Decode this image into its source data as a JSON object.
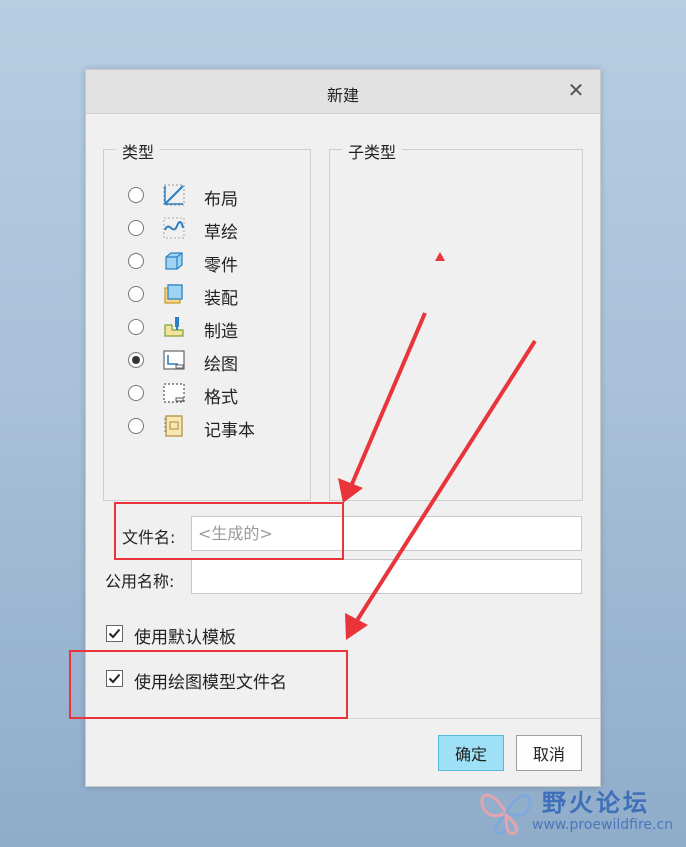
{
  "dialog": {
    "title": "新建",
    "close_icon": "close-icon"
  },
  "type_group": {
    "legend": "类型",
    "items": [
      {
        "label": "布局",
        "icon": "layout-icon",
        "selected": false
      },
      {
        "label": "草绘",
        "icon": "sketch-icon",
        "selected": false
      },
      {
        "label": "零件",
        "icon": "part-icon",
        "selected": false
      },
      {
        "label": "装配",
        "icon": "assembly-icon",
        "selected": false
      },
      {
        "label": "制造",
        "icon": "manufacturing-icon",
        "selected": false
      },
      {
        "label": "绘图",
        "icon": "drawing-icon",
        "selected": true
      },
      {
        "label": "格式",
        "icon": "format-icon",
        "selected": false
      },
      {
        "label": "记事本",
        "icon": "notebook-icon",
        "selected": false
      }
    ]
  },
  "subtype_group": {
    "legend": "子类型"
  },
  "file_name": {
    "label": "文件名:",
    "value": "",
    "placeholder": "<生成的>"
  },
  "common_name": {
    "label": "公用名称:",
    "value": ""
  },
  "options": {
    "use_default_template": {
      "label": "使用默认模板",
      "checked": true
    },
    "use_drawing_model_name": {
      "label": "使用绘图模型文件名",
      "checked": true
    }
  },
  "buttons": {
    "ok": "确定",
    "cancel": "取消"
  },
  "watermark": {
    "title": "野火论坛",
    "url": "www.proewildfire.cn"
  },
  "colors": {
    "annotation": "#e8343a",
    "ok_button": "#9ee0f6",
    "icon_blue": "#2b7fc2"
  }
}
